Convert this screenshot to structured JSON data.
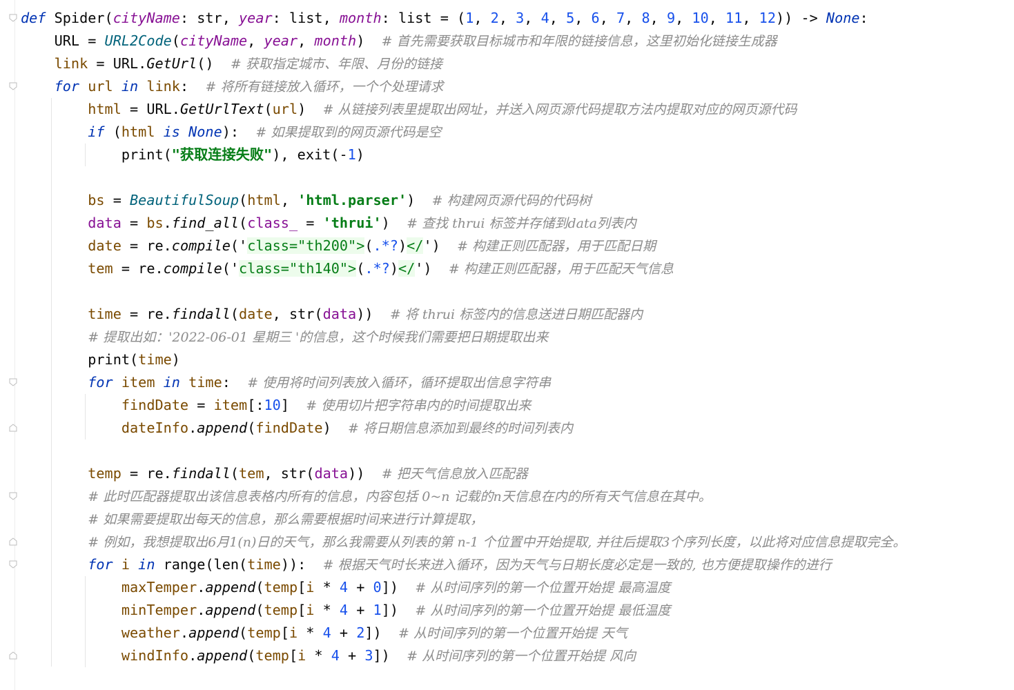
{
  "editor": {
    "language": "python",
    "lines": [
      [
        {
          "t": "def",
          "c": "kw"
        },
        {
          "t": " Spider("
        },
        {
          "t": "cityName",
          "c": "param it"
        },
        {
          "t": ": str, "
        },
        {
          "t": "year",
          "c": "param it"
        },
        {
          "t": ": list, "
        },
        {
          "t": "month",
          "c": "param it"
        },
        {
          "t": ": list = ("
        },
        {
          "t": "1",
          "c": "num"
        },
        {
          "t": ", "
        },
        {
          "t": "2",
          "c": "num"
        },
        {
          "t": ", "
        },
        {
          "t": "3",
          "c": "num"
        },
        {
          "t": ", "
        },
        {
          "t": "4",
          "c": "num"
        },
        {
          "t": ", "
        },
        {
          "t": "5",
          "c": "num"
        },
        {
          "t": ", "
        },
        {
          "t": "6",
          "c": "num"
        },
        {
          "t": ", "
        },
        {
          "t": "7",
          "c": "num"
        },
        {
          "t": ", "
        },
        {
          "t": "8",
          "c": "num"
        },
        {
          "t": ", "
        },
        {
          "t": "9",
          "c": "num"
        },
        {
          "t": ", "
        },
        {
          "t": "10",
          "c": "num"
        },
        {
          "t": ", "
        },
        {
          "t": "11",
          "c": "num"
        },
        {
          "t": ", "
        },
        {
          "t": "12",
          "c": "num"
        },
        {
          "t": ")) -> "
        },
        {
          "t": "None",
          "c": "kw"
        },
        {
          "t": ":"
        }
      ],
      [
        {
          "t": "    URL = "
        },
        {
          "t": "URL2Code",
          "c": "fn it"
        },
        {
          "t": "("
        },
        {
          "t": "cityName",
          "c": "param it"
        },
        {
          "t": ", "
        },
        {
          "t": "year",
          "c": "param it"
        },
        {
          "t": ", "
        },
        {
          "t": "month",
          "c": "param it"
        },
        {
          "t": ")  "
        },
        {
          "t": "# 首先需要获取目标城市和年限的链接信息，这里初始化链接生成器",
          "c": "cmt"
        }
      ],
      [
        {
          "t": "    "
        },
        {
          "t": "link",
          "c": "loc"
        },
        {
          "t": " = URL."
        },
        {
          "t": "GetUrl",
          "c": "it"
        },
        {
          "t": "()  "
        },
        {
          "t": "# 获取指定城市、年限、月份的链接",
          "c": "cmt"
        }
      ],
      [
        {
          "t": "    "
        },
        {
          "t": "for",
          "c": "kw"
        },
        {
          "t": " "
        },
        {
          "t": "url",
          "c": "loc"
        },
        {
          "t": " "
        },
        {
          "t": "in",
          "c": "kw"
        },
        {
          "t": " "
        },
        {
          "t": "link",
          "c": "loc"
        },
        {
          "t": ":  "
        },
        {
          "t": "# 将所有链接放入循环，一个个处理请求",
          "c": "cmt"
        }
      ],
      [
        {
          "t": "        "
        },
        {
          "t": "html",
          "c": "loc"
        },
        {
          "t": " = URL."
        },
        {
          "t": "GetUrlText",
          "c": "it"
        },
        {
          "t": "("
        },
        {
          "t": "url",
          "c": "loc"
        },
        {
          "t": ")  "
        },
        {
          "t": "# 从链接列表里提取出网址，并送入网页源代码提取方法内提取对应的网页源代码",
          "c": "cmt"
        }
      ],
      [
        {
          "t": "        "
        },
        {
          "t": "if",
          "c": "kw"
        },
        {
          "t": " ("
        },
        {
          "t": "html",
          "c": "loc"
        },
        {
          "t": " "
        },
        {
          "t": "is",
          "c": "kw"
        },
        {
          "t": " "
        },
        {
          "t": "None",
          "c": "kw"
        },
        {
          "t": "):  "
        },
        {
          "t": "# 如果提取到的网页源代码是空",
          "c": "cmt"
        }
      ],
      [
        {
          "t": "            print("
        },
        {
          "t": "\"获取连接失败\"",
          "c": "str"
        },
        {
          "t": "), exit(-"
        },
        {
          "t": "1",
          "c": "num"
        },
        {
          "t": ")"
        }
      ],
      [
        {
          "t": ""
        }
      ],
      [
        {
          "t": "        "
        },
        {
          "t": "bs",
          "c": "loc"
        },
        {
          "t": " = "
        },
        {
          "t": "BeautifulSoup",
          "c": "fn it"
        },
        {
          "t": "("
        },
        {
          "t": "html",
          "c": "loc"
        },
        {
          "t": ", "
        },
        {
          "t": "'html.parser'",
          "c": "str"
        },
        {
          "t": ")  "
        },
        {
          "t": "# 构建网页源代码的代码树",
          "c": "cmt"
        }
      ],
      [
        {
          "t": "        "
        },
        {
          "t": "data",
          "c": "param"
        },
        {
          "t": " = "
        },
        {
          "t": "bs",
          "c": "loc"
        },
        {
          "t": "."
        },
        {
          "t": "find_all",
          "c": "it"
        },
        {
          "t": "("
        },
        {
          "t": "class_",
          "c": "param"
        },
        {
          "t": " = "
        },
        {
          "t": "'thrui'",
          "c": "str"
        },
        {
          "t": ")  "
        },
        {
          "t": "# 查找 thrui 标签并存储到data列表内",
          "c": "cmt"
        }
      ],
      [
        {
          "t": "        "
        },
        {
          "t": "date",
          "c": "loc"
        },
        {
          "t": " = re."
        },
        {
          "t": "compile",
          "c": "it"
        },
        {
          "t": "('"
        },
        {
          "t": "class=\"th200\">",
          "c": "sub"
        },
        {
          "t": "("
        },
        {
          "t": ".*?",
          "c": "num"
        },
        {
          "t": ")"
        },
        {
          "t": "</",
          "c": "sub"
        },
        {
          "t": "')  "
        },
        {
          "t": "# 构建正则匹配器，用于匹配日期",
          "c": "cmt"
        }
      ],
      [
        {
          "t": "        "
        },
        {
          "t": "tem",
          "c": "loc"
        },
        {
          "t": " = re."
        },
        {
          "t": "compile",
          "c": "it"
        },
        {
          "t": "('"
        },
        {
          "t": "class=\"th140\">",
          "c": "sub"
        },
        {
          "t": "("
        },
        {
          "t": ".*?",
          "c": "num"
        },
        {
          "t": ")"
        },
        {
          "t": "</",
          "c": "sub"
        },
        {
          "t": "')  "
        },
        {
          "t": "# 构建正则匹配器，用于匹配天气信息",
          "c": "cmt"
        }
      ],
      [
        {
          "t": ""
        }
      ],
      [
        {
          "t": "        "
        },
        {
          "t": "time",
          "c": "loc"
        },
        {
          "t": " = re."
        },
        {
          "t": "findall",
          "c": "it"
        },
        {
          "t": "("
        },
        {
          "t": "date",
          "c": "loc"
        },
        {
          "t": ", str("
        },
        {
          "t": "data",
          "c": "param"
        },
        {
          "t": "))  "
        },
        {
          "t": "# 将 thrui 标签内的信息送进日期匹配器内",
          "c": "cmt"
        }
      ],
      [
        {
          "t": "        "
        },
        {
          "t": "# 提取出如：'2022-06-01 星期三 '的信息，这个时候我们需要把日期提取出来",
          "c": "cmt"
        }
      ],
      [
        {
          "t": "        print("
        },
        {
          "t": "time",
          "c": "loc"
        },
        {
          "t": ")"
        }
      ],
      [
        {
          "t": "        "
        },
        {
          "t": "for",
          "c": "kw"
        },
        {
          "t": " "
        },
        {
          "t": "item",
          "c": "loc"
        },
        {
          "t": " "
        },
        {
          "t": "in",
          "c": "kw"
        },
        {
          "t": " "
        },
        {
          "t": "time",
          "c": "loc"
        },
        {
          "t": ":  "
        },
        {
          "t": "# 使用将时间列表放入循环，循环提取出信息字符串",
          "c": "cmt"
        }
      ],
      [
        {
          "t": "            "
        },
        {
          "t": "findDate",
          "c": "loc"
        },
        {
          "t": " = "
        },
        {
          "t": "item",
          "c": "loc"
        },
        {
          "t": "[:"
        },
        {
          "t": "10",
          "c": "num"
        },
        {
          "t": "]  "
        },
        {
          "t": "# 使用切片把字符串内的时间提取出来",
          "c": "cmt"
        }
      ],
      [
        {
          "t": "            "
        },
        {
          "t": "dateInfo",
          "c": "loc"
        },
        {
          "t": "."
        },
        {
          "t": "append",
          "c": "it"
        },
        {
          "t": "("
        },
        {
          "t": "findDate",
          "c": "loc"
        },
        {
          "t": ")  "
        },
        {
          "t": "# 将日期信息添加到最终的时间列表内",
          "c": "cmt"
        }
      ],
      [
        {
          "t": ""
        }
      ],
      [
        {
          "t": "        "
        },
        {
          "t": "temp",
          "c": "loc"
        },
        {
          "t": " = re."
        },
        {
          "t": "findall",
          "c": "it"
        },
        {
          "t": "("
        },
        {
          "t": "tem",
          "c": "loc"
        },
        {
          "t": ", str("
        },
        {
          "t": "data",
          "c": "param"
        },
        {
          "t": "))  "
        },
        {
          "t": "# 把天气信息放入匹配器",
          "c": "cmt"
        }
      ],
      [
        {
          "t": "        "
        },
        {
          "t": "# 此时匹配器提取出该信息表格内所有的信息，内容包括 0~n 记载的n天信息在内的所有天气信息在其中。",
          "c": "cmt"
        }
      ],
      [
        {
          "t": "        "
        },
        {
          "t": "# 如果需要提取出每天的信息，那么需要根据时间来进行计算提取，",
          "c": "cmt"
        }
      ],
      [
        {
          "t": "        "
        },
        {
          "t": "# 例如，我想提取出6月1(n)日的天气，那么我需要从列表的第 n-1 个位置中开始提取, 并往后提取3个序列长度，以此将对应信息提取完全。",
          "c": "cmt"
        }
      ],
      [
        {
          "t": "        "
        },
        {
          "t": "for",
          "c": "kw"
        },
        {
          "t": " "
        },
        {
          "t": "i",
          "c": "loc"
        },
        {
          "t": " "
        },
        {
          "t": "in",
          "c": "kw"
        },
        {
          "t": " range(len("
        },
        {
          "t": "time",
          "c": "loc"
        },
        {
          "t": ")):  "
        },
        {
          "t": "# 根据天气时长来进入循环，因为天气与日期长度必定是一致的, 也方便提取操作的进行",
          "c": "cmt"
        }
      ],
      [
        {
          "t": "            "
        },
        {
          "t": "maxTemper",
          "c": "loc"
        },
        {
          "t": "."
        },
        {
          "t": "append",
          "c": "it"
        },
        {
          "t": "("
        },
        {
          "t": "temp",
          "c": "loc"
        },
        {
          "t": "["
        },
        {
          "t": "i",
          "c": "loc"
        },
        {
          "t": " * "
        },
        {
          "t": "4",
          "c": "num"
        },
        {
          "t": " + "
        },
        {
          "t": "0",
          "c": "num"
        },
        {
          "t": "])  "
        },
        {
          "t": "# 从时间序列的第一个位置开始提 最高温度",
          "c": "cmt"
        }
      ],
      [
        {
          "t": "            "
        },
        {
          "t": "minTemper",
          "c": "loc"
        },
        {
          "t": "."
        },
        {
          "t": "append",
          "c": "it"
        },
        {
          "t": "("
        },
        {
          "t": "temp",
          "c": "loc"
        },
        {
          "t": "["
        },
        {
          "t": "i",
          "c": "loc"
        },
        {
          "t": " * "
        },
        {
          "t": "4",
          "c": "num"
        },
        {
          "t": " + "
        },
        {
          "t": "1",
          "c": "num"
        },
        {
          "t": "])  "
        },
        {
          "t": "# 从时间序列的第一个位置开始提 最低温度",
          "c": "cmt"
        }
      ],
      [
        {
          "t": "            "
        },
        {
          "t": "weather",
          "c": "loc"
        },
        {
          "t": "."
        },
        {
          "t": "append",
          "c": "it"
        },
        {
          "t": "("
        },
        {
          "t": "temp",
          "c": "loc"
        },
        {
          "t": "["
        },
        {
          "t": "i",
          "c": "loc"
        },
        {
          "t": " * "
        },
        {
          "t": "4",
          "c": "num"
        },
        {
          "t": " + "
        },
        {
          "t": "2",
          "c": "num"
        },
        {
          "t": "])  "
        },
        {
          "t": "# 从时间序列的第一个位置开始提 天气",
          "c": "cmt"
        }
      ],
      [
        {
          "t": "            "
        },
        {
          "t": "windInfo",
          "c": "loc"
        },
        {
          "t": "."
        },
        {
          "t": "append",
          "c": "it"
        },
        {
          "t": "("
        },
        {
          "t": "temp",
          "c": "loc"
        },
        {
          "t": "["
        },
        {
          "t": "i",
          "c": "loc"
        },
        {
          "t": " * "
        },
        {
          "t": "4",
          "c": "num"
        },
        {
          "t": " + "
        },
        {
          "t": "3",
          "c": "num"
        },
        {
          "t": "])  "
        },
        {
          "t": "# 从时间序列的第一个位置开始提 风向",
          "c": "cmt"
        }
      ]
    ]
  }
}
